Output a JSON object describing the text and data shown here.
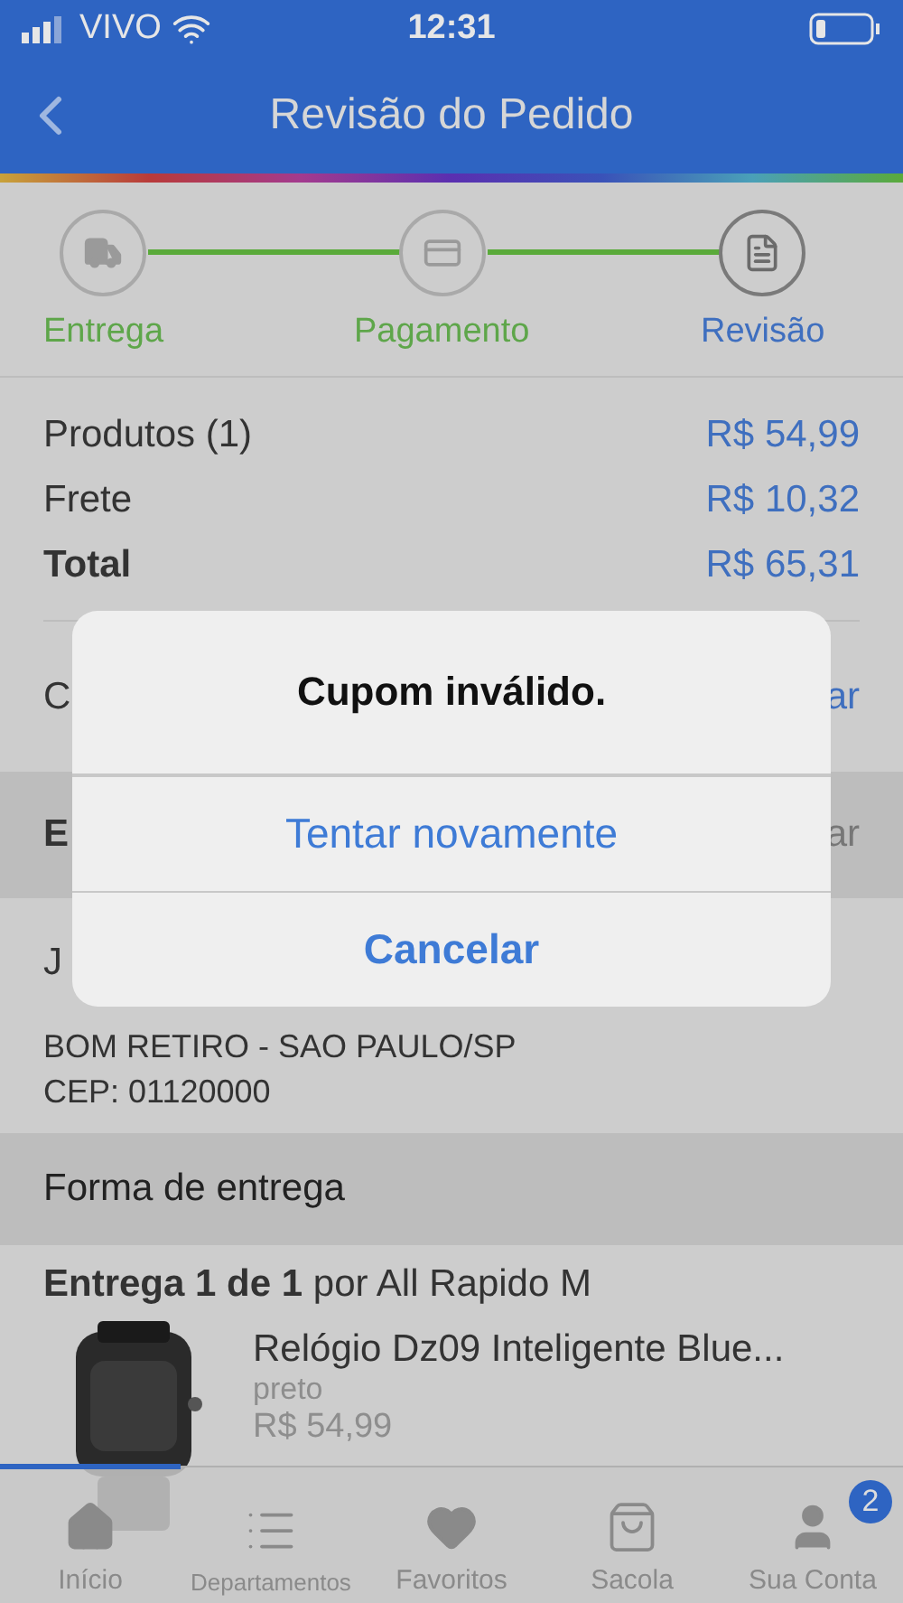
{
  "status_bar": {
    "carrier": "VIVO",
    "time": "12:31"
  },
  "header": {
    "title": "Revisão do Pedido"
  },
  "steps": [
    {
      "label": "Entrega",
      "selected": false,
      "kind": "truck"
    },
    {
      "label": "Pagamento",
      "selected": false,
      "kind": "card"
    },
    {
      "label": "Revisão",
      "selected": true,
      "kind": "document"
    }
  ],
  "summary": [
    {
      "label": "Produtos (1)",
      "value": "R$ 54,99",
      "bold": false
    },
    {
      "label": "Frete",
      "value": "R$ 10,32",
      "bold": false
    },
    {
      "label": "Total",
      "value": "R$ 65,31",
      "bold": true
    }
  ],
  "coupon_row": {
    "label": "C",
    "action": "ar"
  },
  "address_header": {
    "label": "E",
    "action": "ar"
  },
  "address": {
    "name": "J",
    "line": "BOM RETIRO - SAO PAULO/SP",
    "cep": "CEP: 01120000"
  },
  "shipping_header": "Forma de entrega",
  "delivery": "**Entrega 1 de 1** por All Rapido M",
  "product": {
    "title": "Relógio Dz09 Inteligente Blue...",
    "variant": "preto",
    "price": "R$ 54,99"
  },
  "tabs": [
    {
      "label": "Início",
      "kind": "home",
      "selected": true
    },
    {
      "label": "Departamentos",
      "kind": "list",
      "selected": false
    },
    {
      "label": "Favoritos",
      "kind": "heart",
      "selected": false
    },
    {
      "label": "Sacola",
      "kind": "bag",
      "selected": false
    },
    {
      "label": "Sua Conta",
      "kind": "user",
      "selected": false,
      "badge": "2"
    }
  ],
  "dialog": {
    "title": "Cupom inválido.",
    "buttons": [
      {
        "label": "Tentar novamente",
        "kind": "default"
      },
      {
        "label": "Cancelar",
        "kind": "cancel"
      }
    ]
  }
}
